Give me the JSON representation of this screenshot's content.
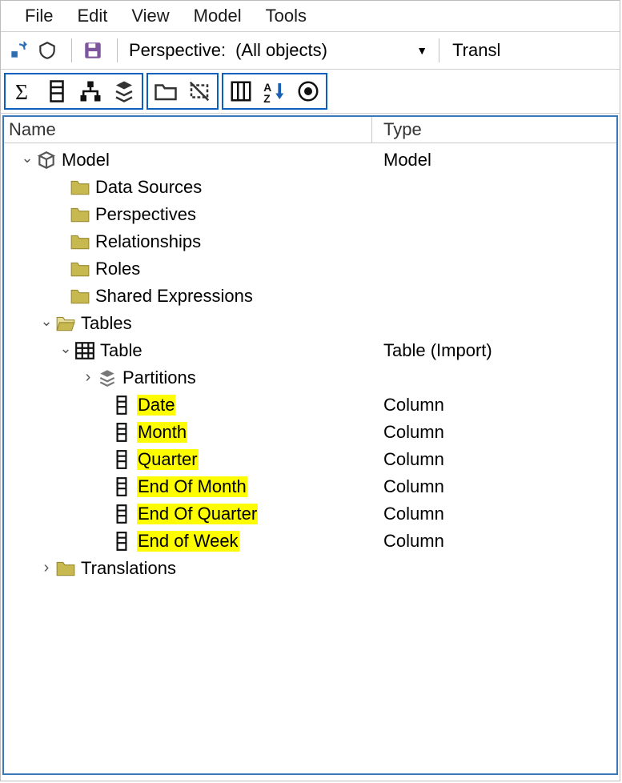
{
  "menu": {
    "file": "File",
    "edit": "Edit",
    "view": "View",
    "model": "Model",
    "tools": "Tools"
  },
  "toolbar1": {
    "perspective_label": "Perspective:",
    "perspective_value": "(All objects)",
    "translations_label": "Transl"
  },
  "headers": {
    "name": "Name",
    "type": "Type"
  },
  "tree": {
    "model": {
      "label": "Model",
      "type": "Model"
    },
    "data_sources": {
      "label": "Data Sources",
      "type": ""
    },
    "perspectives": {
      "label": "Perspectives",
      "type": ""
    },
    "relationships": {
      "label": "Relationships",
      "type": ""
    },
    "roles": {
      "label": "Roles",
      "type": ""
    },
    "shared_expr": {
      "label": "Shared Expressions",
      "type": ""
    },
    "tables": {
      "label": "Tables",
      "type": ""
    },
    "table": {
      "label": "Table",
      "type": "Table (Import)"
    },
    "partitions": {
      "label": "Partitions",
      "type": ""
    },
    "col_date": {
      "label": "Date",
      "type": "Column"
    },
    "col_month": {
      "label": "Month",
      "type": "Column"
    },
    "col_quarter": {
      "label": "Quarter",
      "type": "Column"
    },
    "col_eom": {
      "label": "End Of Month",
      "type": "Column"
    },
    "col_eoq": {
      "label": "End Of Quarter",
      "type": "Column"
    },
    "col_eow": {
      "label": "End of Week",
      "type": "Column"
    },
    "translations": {
      "label": "Translations",
      "type": ""
    }
  }
}
